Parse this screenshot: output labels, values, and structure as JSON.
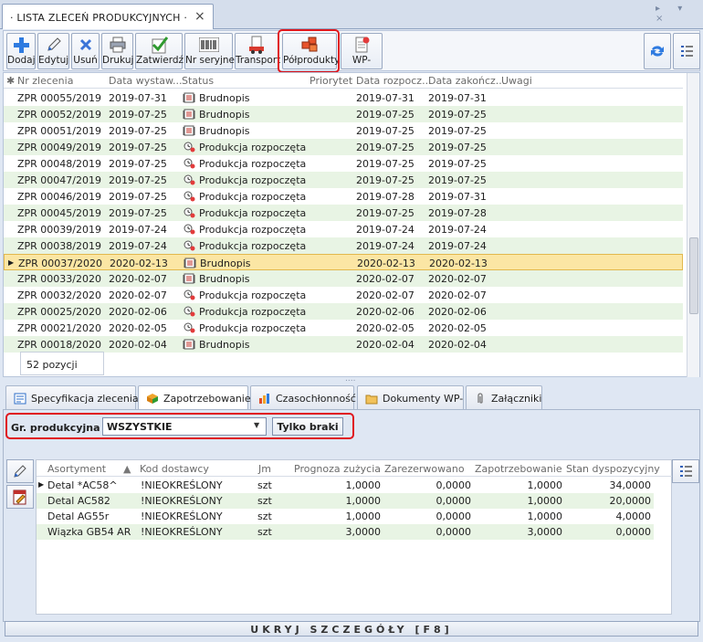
{
  "window": {
    "tab_title": "· LISTA ZLECEŃ PRODUKCYJNYCH ·",
    "tab_close": "×",
    "controls": "▸ ▾ ×"
  },
  "toolbar": {
    "buttons": [
      {
        "label": "Dodaj",
        "icon": "plus-icon"
      },
      {
        "label": "Edytuj",
        "icon": "pencil-icon"
      },
      {
        "label": "Usuń",
        "icon": "delete-x-icon"
      },
      {
        "label": "Drukuj",
        "icon": "printer-icon"
      },
      {
        "label": "Zatwierdź",
        "icon": "approve-check-icon"
      },
      {
        "label": "Nr seryjne",
        "icon": "barcode-icon"
      },
      {
        "label": "Transport",
        "icon": "transport-icon"
      },
      {
        "label": "Półprodukty",
        "icon": "semi-products-icon"
      },
      {
        "label": "WP-",
        "icon": "wp-document-icon"
      }
    ],
    "right_buttons": [
      "refresh-icon",
      "column-chooser-icon"
    ]
  },
  "grid": {
    "headers": {
      "nr": "Nr zlecenia",
      "data_wyst": "Data wystaw...",
      "status": "Status",
      "priorytet": "Priorytet",
      "data_rozp": "Data rozpocz...",
      "data_zak": "Data zakończ...",
      "uwagi": "Uwagi"
    },
    "rows": [
      {
        "nr": "ZPR 00055/2019",
        "data_wyst": "2019-07-31",
        "status": "Brudnopis",
        "data_rozp": "2019-07-31",
        "data_zak": "2019-07-31"
      },
      {
        "nr": "ZPR 00052/2019",
        "data_wyst": "2019-07-25",
        "status": "Brudnopis",
        "data_rozp": "2019-07-25",
        "data_zak": "2019-07-25"
      },
      {
        "nr": "ZPR 00051/2019",
        "data_wyst": "2019-07-25",
        "status": "Brudnopis",
        "data_rozp": "2019-07-25",
        "data_zak": "2019-07-25"
      },
      {
        "nr": "ZPR 00049/2019",
        "data_wyst": "2019-07-25",
        "status": "Produkcja rozpoczęta",
        "data_rozp": "2019-07-25",
        "data_zak": "2019-07-25"
      },
      {
        "nr": "ZPR 00048/2019",
        "data_wyst": "2019-07-25",
        "status": "Produkcja rozpoczęta",
        "data_rozp": "2019-07-25",
        "data_zak": "2019-07-25"
      },
      {
        "nr": "ZPR 00047/2019",
        "data_wyst": "2019-07-25",
        "status": "Produkcja rozpoczęta",
        "data_rozp": "2019-07-25",
        "data_zak": "2019-07-25"
      },
      {
        "nr": "ZPR 00046/2019",
        "data_wyst": "2019-07-25",
        "status": "Produkcja rozpoczęta",
        "data_rozp": "2019-07-28",
        "data_zak": "2019-07-31"
      },
      {
        "nr": "ZPR 00045/2019",
        "data_wyst": "2019-07-25",
        "status": "Produkcja rozpoczęta",
        "data_rozp": "2019-07-25",
        "data_zak": "2019-07-28"
      },
      {
        "nr": "ZPR 00039/2019",
        "data_wyst": "2019-07-24",
        "status": "Produkcja rozpoczęta",
        "data_rozp": "2019-07-24",
        "data_zak": "2019-07-24"
      },
      {
        "nr": "ZPR 00038/2019",
        "data_wyst": "2019-07-24",
        "status": "Produkcja rozpoczęta",
        "data_rozp": "2019-07-24",
        "data_zak": "2019-07-24"
      },
      {
        "nr": "ZPR 00037/2020",
        "data_wyst": "2020-02-13",
        "status": "Brudnopis",
        "data_rozp": "2020-02-13",
        "data_zak": "2020-02-13"
      },
      {
        "nr": "ZPR 00033/2020",
        "data_wyst": "2020-02-07",
        "status": "Brudnopis",
        "data_rozp": "2020-02-07",
        "data_zak": "2020-02-07"
      },
      {
        "nr": "ZPR 00032/2020",
        "data_wyst": "2020-02-07",
        "status": "Produkcja rozpoczęta",
        "data_rozp": "2020-02-07",
        "data_zak": "2020-02-07"
      },
      {
        "nr": "ZPR 00025/2020",
        "data_wyst": "2020-02-06",
        "status": "Produkcja rozpoczęta",
        "data_rozp": "2020-02-06",
        "data_zak": "2020-02-06"
      },
      {
        "nr": "ZPR 00021/2020",
        "data_wyst": "2020-02-05",
        "status": "Produkcja rozpoczęta",
        "data_rozp": "2020-02-05",
        "data_zak": "2020-02-05"
      },
      {
        "nr": "ZPR 00018/2020",
        "data_wyst": "2020-02-04",
        "status": "Brudnopis",
        "data_rozp": "2020-02-04",
        "data_zak": "2020-02-04"
      }
    ],
    "count": "52 pozycji"
  },
  "lower_tabs": [
    "Specyfikacja zlecenia",
    "Zapotrzebowanie",
    "Czasochłonność",
    "Dokumenty WP-",
    "Załączniki"
  ],
  "filter": {
    "label": "Gr. produkcyjna",
    "value": "WSZYSTKIE",
    "button": "Tylko braki"
  },
  "grid2": {
    "headers": {
      "asortyment": "Asortyment",
      "kod": "Kod dostawcy",
      "jm": "Jm",
      "prognoza": "Prognoza zużycia",
      "zarez": "Zarezerwowano",
      "zapotrz": "Zapotrzebowanie",
      "stan": "Stan dyspozycyjny"
    },
    "rows": [
      {
        "asortyment": "Detal *AC58^",
        "kod": "!NIEOKREŚLONY",
        "jm": "szt",
        "prognoza": "1,0000",
        "zarez": "0,0000",
        "zapotrz": "1,0000",
        "stan": "34,0000"
      },
      {
        "asortyment": "Detal AC582",
        "kod": "!NIEOKREŚLONY",
        "jm": "szt",
        "prognoza": "1,0000",
        "zarez": "0,0000",
        "zapotrz": "1,0000",
        "stan": "20,0000"
      },
      {
        "asortyment": "Detal AG55r",
        "kod": "!NIEOKREŚLONY",
        "jm": "szt",
        "prognoza": "1,0000",
        "zarez": "0,0000",
        "zapotrz": "1,0000",
        "stan": "4,0000"
      },
      {
        "asortyment": "Wiązka GB54 AR",
        "kod": "!NIEOKREŚLONY",
        "jm": "szt",
        "prognoza": "3,0000",
        "zarez": "0,0000",
        "zapotrz": "3,0000",
        "stan": "0,0000"
      }
    ]
  },
  "footer": "UKRYJ SZCZEGÓŁY [F8]",
  "colors": {
    "highlight": "#e0161c",
    "row_alt": "#e8f4e4",
    "row_selected": "#fbe6a4"
  }
}
